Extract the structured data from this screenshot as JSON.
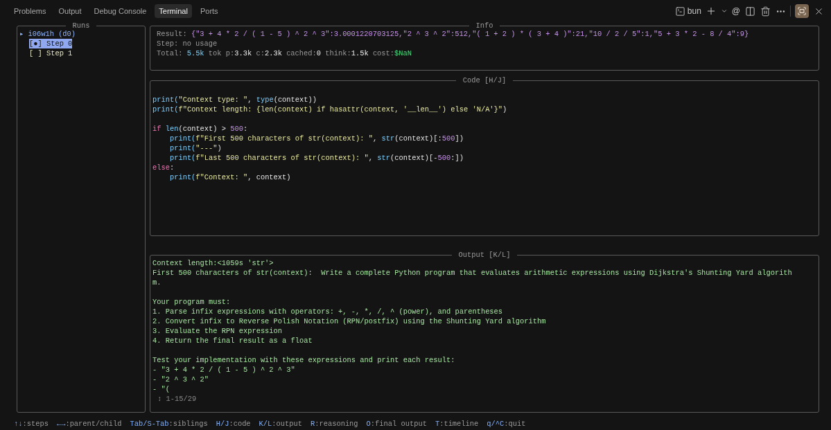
{
  "tabs": [
    {
      "label": "Problems",
      "selected": false
    },
    {
      "label": "Output",
      "selected": false
    },
    {
      "label": "Debug Console",
      "selected": false
    },
    {
      "label": "Terminal",
      "selected": true
    },
    {
      "label": "Ports",
      "selected": false
    }
  ],
  "toolbar": {
    "shell": "bun",
    "mention": "@",
    "maximized": true
  },
  "runs": {
    "title": "Runs",
    "items": [
      {
        "label": "i06w1h (d0)",
        "marker": "▸",
        "children": [
          {
            "label": "[●] Step 0",
            "selected": true
          },
          {
            "label": "[ ] Step 1",
            "selected": false
          }
        ]
      }
    ]
  },
  "info": {
    "title": "Info",
    "lines": [
      [
        {
          "text": "Result: ",
          "kind": "dim"
        },
        {
          "text": "{\"3 + 4 * 2 / ( 1 - 5 ) ^ 2 ^ 3\":3.0001220703125,\"2 ^ 3 ^ 2\":512,\"( 1 + 2 ) * ( 3 + 4 )\":21,\"10 / 2 / 5\":1,\"5 + 3 * 2 - 8 / 4\":9}",
          "kind": "num"
        }
      ],
      [
        {
          "text": "Step: no usage",
          "kind": "dim"
        }
      ],
      [
        {
          "text": "Total: ",
          "kind": "dim"
        },
        {
          "text": "5.5k",
          "kind": "cyan"
        },
        {
          "text": " tok p:",
          "kind": "dim"
        },
        {
          "text": "3.3k",
          "kind": "bright"
        },
        {
          "text": " c:",
          "kind": "dim"
        },
        {
          "text": "2.3k",
          "kind": "bright"
        },
        {
          "text": " cached:",
          "kind": "dim"
        },
        {
          "text": "0",
          "kind": "bright"
        },
        {
          "text": " think:",
          "kind": "dim"
        },
        {
          "text": "1.5k",
          "kind": "bright"
        },
        {
          "text": " cost:",
          "kind": "dim"
        },
        {
          "text": "$NaN",
          "kind": "green"
        }
      ]
    ]
  },
  "code": {
    "title": "Code [H/J]",
    "blocks": [
      [
        [
          {
            "text": "print(",
            "kind": "fn"
          },
          {
            "text": "\"Context type: \"",
            "kind": "str"
          },
          {
            "text": ", ",
            "kind": "plain"
          },
          {
            "text": "type",
            "kind": "fn"
          },
          {
            "text": "(context))",
            "kind": "plain"
          }
        ],
        [
          {
            "text": "print(",
            "kind": "fn"
          },
          {
            "text": "f\"Context length: {len(context) if hasattr(context, '__len__') else 'N/A'}\"",
            "kind": "str"
          },
          {
            "text": ")",
            "kind": "plain"
          }
        ]
      ],
      [
        [
          {
            "text": "if",
            "kind": "kw"
          },
          {
            "text": " len",
            "kind": "fn"
          },
          {
            "text": "(context) > ",
            "kind": "plain"
          },
          {
            "text": "500",
            "kind": "num"
          },
          {
            "text": ":",
            "kind": "plain"
          }
        ],
        [
          {
            "text": "    print(",
            "kind": "fn"
          },
          {
            "text": "f\"First 500 characters of str(context): \"",
            "kind": "str"
          },
          {
            "text": ", ",
            "kind": "plain"
          },
          {
            "text": "str",
            "kind": "fn"
          },
          {
            "text": "(context)[:",
            "kind": "plain"
          },
          {
            "text": "500",
            "kind": "num"
          },
          {
            "text": "])",
            "kind": "plain"
          }
        ],
        [
          {
            "text": "    print(",
            "kind": "fn"
          },
          {
            "text": "\"---\"",
            "kind": "str"
          },
          {
            "text": ")",
            "kind": "plain"
          }
        ],
        [
          {
            "text": "    print(",
            "kind": "fn"
          },
          {
            "text": "f\"Last 500 characters of str(context): \"",
            "kind": "str"
          },
          {
            "text": ", ",
            "kind": "plain"
          },
          {
            "text": "str",
            "kind": "fn"
          },
          {
            "text": "(context)[-",
            "kind": "plain"
          },
          {
            "text": "500",
            "kind": "num"
          },
          {
            "text": ":])",
            "kind": "plain"
          }
        ],
        [
          {
            "text": "else",
            "kind": "kw"
          },
          {
            "text": ":",
            "kind": "plain"
          }
        ],
        [
          {
            "text": "    print(",
            "kind": "fn"
          },
          {
            "text": "f\"Context: \"",
            "kind": "str"
          },
          {
            "text": ", context)",
            "kind": "plain"
          }
        ]
      ]
    ]
  },
  "output": {
    "title": "Output [K/L]",
    "blocks": [
      [
        "Context length:<1059s 'str'>",
        "First 500 characters of str(context):  Write a complete Python program that evaluates arithmetic expressions using Dijkstra's Shunting Yard algorith",
        "m."
      ],
      [
        "Your program must:",
        "1. Parse infix expressions with operators: +, -, *, /, ^ (power), and parentheses",
        "2. Convert infix to Reverse Polish Notation (RPN/postfix) using the Shunting Yard algorithm",
        "3. Evaluate the RPN expression",
        "4. Return the final result as a float"
      ],
      [
        "Test your implementation with these expressions and print each result:",
        "- \"3 + 4 * 2 / ( 1 - 5 ) ^ 2 ^ 3\"",
        "- \"2 ^ 3 ^ 2\"",
        "- \"("
      ]
    ],
    "scroll": "↕ 1-15/29"
  },
  "shortcuts": [
    {
      "key": "↑↓",
      "action": ":steps"
    },
    {
      "key": "←→",
      "action": ":parent/child"
    },
    {
      "key": "Tab/S-Tab",
      "action": ":siblings"
    },
    {
      "key": "H/J",
      "action": ":code"
    },
    {
      "key": "K/L",
      "action": ":output"
    },
    {
      "key": "R",
      "action": ":reasoning"
    },
    {
      "key": "O",
      "action": ":final output"
    },
    {
      "key": "T",
      "action": ":timeline"
    },
    {
      "key": "q/^C",
      "action": ":quit"
    }
  ]
}
